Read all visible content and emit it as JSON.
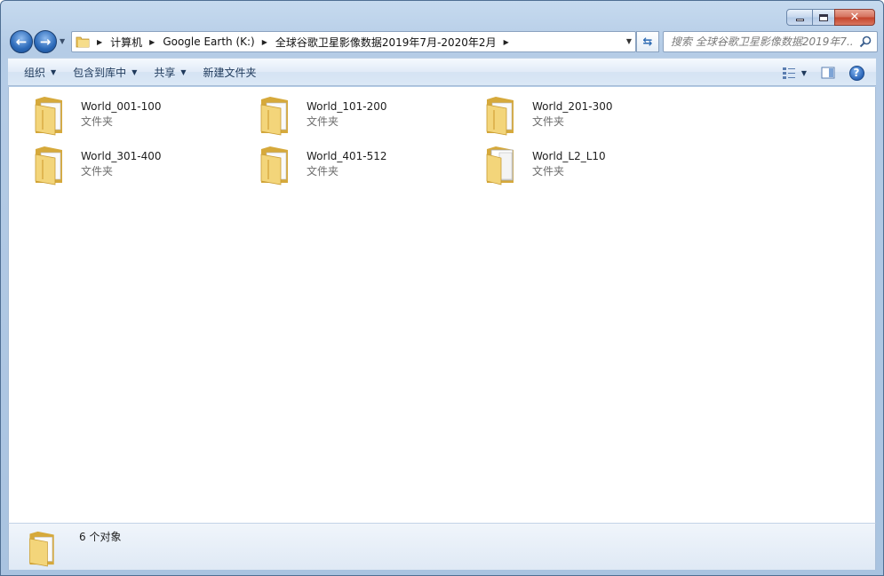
{
  "window": {
    "caption": {
      "minimize": "minimize",
      "maximize": "maximize",
      "close": "✕"
    }
  },
  "nav": {
    "back": "back-arrow-icon",
    "forward": "forward-arrow-icon"
  },
  "address": {
    "crumbs": [
      "计算机",
      "Google Earth (K:)",
      "全球谷歌卫星影像数据2019年7月-2020年2月"
    ]
  },
  "search": {
    "placeholder": "搜索 全球谷歌卫星影像数据2019年7..."
  },
  "toolbar": {
    "organize": "组织",
    "include_in_library": "包含到库中",
    "share": "共享",
    "new_folder": "新建文件夹"
  },
  "files": [
    {
      "name": "World_001-100",
      "type": "文件夹",
      "icon": "folder-icon"
    },
    {
      "name": "World_101-200",
      "type": "文件夹",
      "icon": "folder-icon"
    },
    {
      "name": "World_201-300",
      "type": "文件夹",
      "icon": "folder-icon"
    },
    {
      "name": "World_301-400",
      "type": "文件夹",
      "icon": "folder-icon"
    },
    {
      "name": "World_401-512",
      "type": "文件夹",
      "icon": "folder-icon"
    },
    {
      "name": "World_L2_L10",
      "type": "文件夹",
      "icon": "folder-white-docs-icon"
    }
  ],
  "details": {
    "count_text": "6 个对象"
  },
  "colors": {
    "folder": "#f3d57a",
    "folder_dark": "#d6a93b",
    "accent": "#2b69b8"
  }
}
